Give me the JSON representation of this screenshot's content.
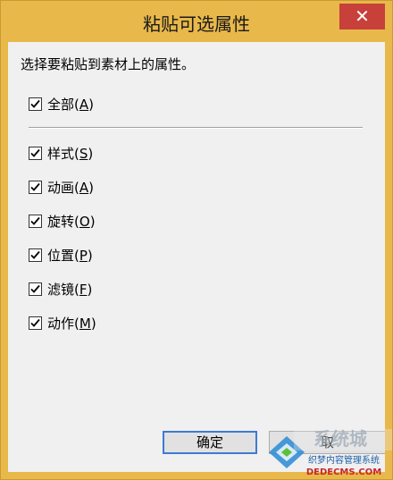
{
  "window": {
    "title": "粘贴可选属性",
    "close_glyph": "✕"
  },
  "instruction": "选择要粘贴到素材上的属性。",
  "all": {
    "label": "全部",
    "mnemonic": "A",
    "checked": true
  },
  "properties": [
    {
      "label": "样式",
      "mnemonic": "S",
      "checked": true
    },
    {
      "label": "动画",
      "mnemonic": "A",
      "checked": true
    },
    {
      "label": "旋转",
      "mnemonic": "O",
      "checked": true
    },
    {
      "label": "位置",
      "mnemonic": "P",
      "checked": true
    },
    {
      "label": "滤镜",
      "mnemonic": "F",
      "checked": true
    },
    {
      "label": "动作",
      "mnemonic": "M",
      "checked": true
    }
  ],
  "buttons": {
    "ok": "确定",
    "cancel": "取"
  },
  "watermark": {
    "text_cn": "织梦内容管理系统",
    "text_en": "DEDECMS.COM"
  },
  "colors": {
    "title_bar": "#e8b84a",
    "close": "#c7403a",
    "focus_border": "#3d7bd3"
  }
}
